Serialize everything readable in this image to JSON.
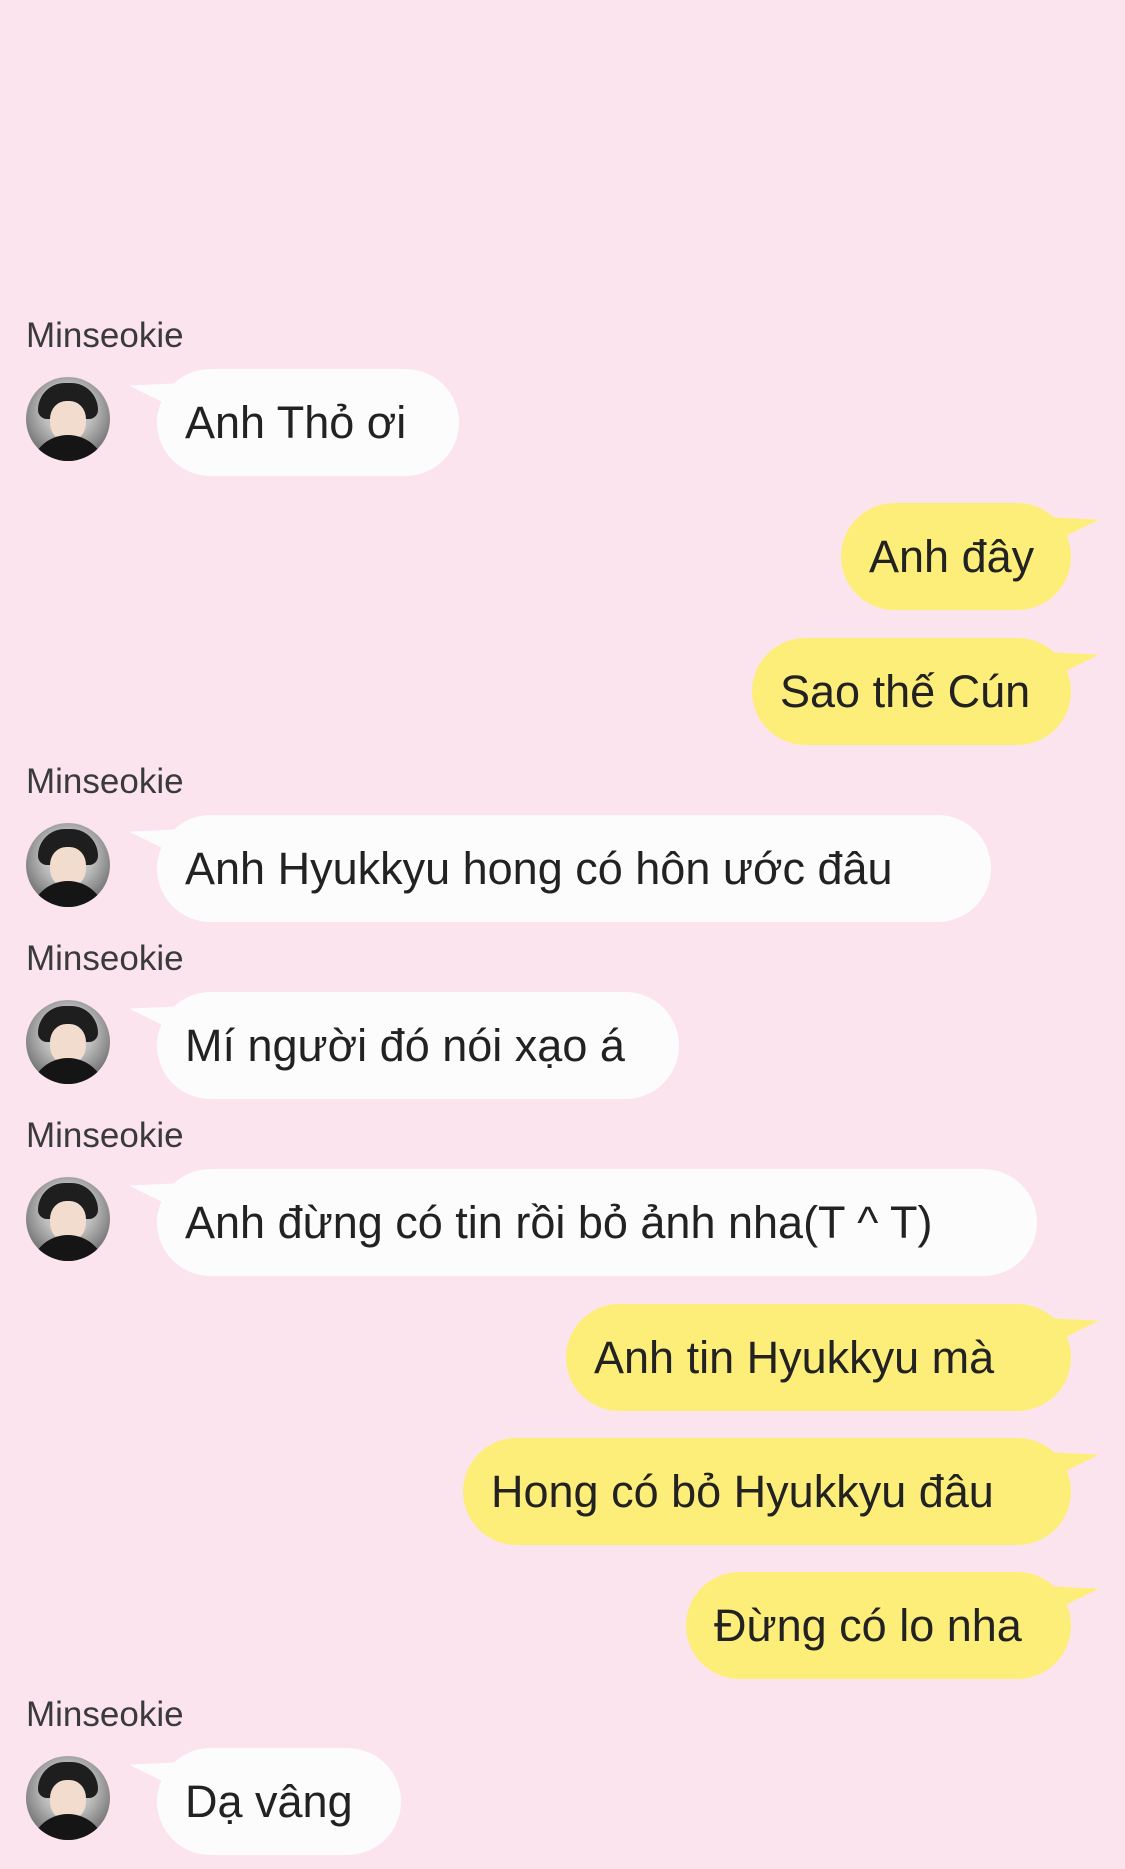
{
  "sender_name": "Minseokie",
  "messages": [
    {
      "side": "in",
      "text": "Anh Thỏ ơi",
      "show_name": true
    },
    {
      "side": "out",
      "text": "Anh đây"
    },
    {
      "side": "out",
      "text": "Sao thế Cún"
    },
    {
      "side": "in",
      "text": "Anh Hyukkyu hong có hôn ước đâu",
      "show_name": true
    },
    {
      "side": "in",
      "text": "Mí người đó nói xạo á",
      "show_name": true
    },
    {
      "side": "in",
      "text": "Anh đừng có tin rồi bỏ ảnh nha(T ^ T)",
      "show_name": true
    },
    {
      "side": "out",
      "text": "Anh tin Hyukkyu mà"
    },
    {
      "side": "out",
      "text": "Hong có bỏ Hyukkyu đâu"
    },
    {
      "side": "out",
      "text": "Đừng có lo nha"
    },
    {
      "side": "in",
      "text": "Dạ vâng",
      "show_name": true
    }
  ],
  "colors": {
    "background": "#fbe4ee",
    "incoming_bubble": "#fcfcfc",
    "outgoing_bubble": "#fdee7a",
    "text": "#222222"
  }
}
